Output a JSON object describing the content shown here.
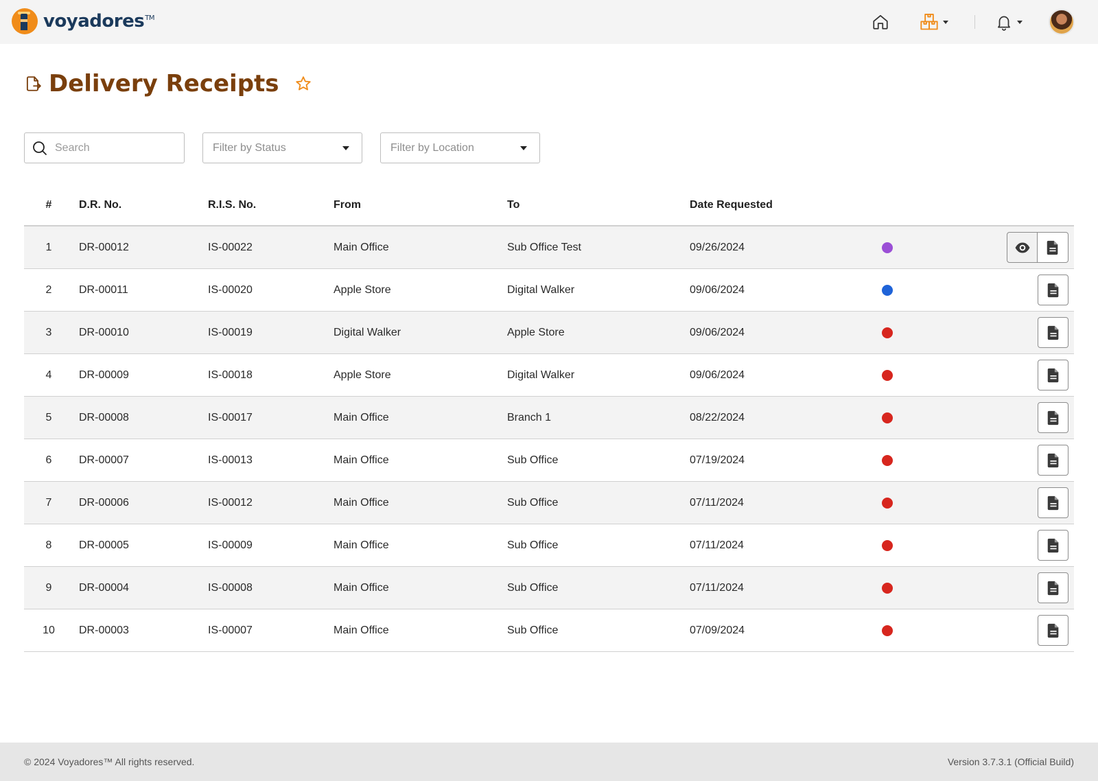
{
  "app": {
    "brand": "voyadores",
    "brand_tm": "TM"
  },
  "nav": {
    "home_icon": "home-icon",
    "inventory_icon": "boxes-icon",
    "notifications_icon": "bell-icon",
    "accent_color": "#f08c1a"
  },
  "page": {
    "title": "Delivery Receipts",
    "title_color": "#7a3f0c"
  },
  "filters": {
    "search_placeholder": "Search",
    "status_placeholder": "Filter by Status",
    "location_placeholder": "Filter by Location"
  },
  "table": {
    "headers": {
      "num": "#",
      "dr": "D.R. No.",
      "ris": "R.I.S. No.",
      "from": "From",
      "to": "To",
      "date": "Date Requested"
    },
    "rows": [
      {
        "num": "1",
        "dr": "DR-00012",
        "ris": "IS-00022",
        "from": "Main Office",
        "to": "Sub Office Test",
        "date": "09/26/2024",
        "status_color": "#9b4fd6",
        "has_view": true
      },
      {
        "num": "2",
        "dr": "DR-00011",
        "ris": "IS-00020",
        "from": "Apple Store",
        "to": "Digital Walker",
        "date": "09/06/2024",
        "status_color": "#1f63d8",
        "has_view": false
      },
      {
        "num": "3",
        "dr": "DR-00010",
        "ris": "IS-00019",
        "from": "Digital Walker",
        "to": "Apple Store",
        "date": "09/06/2024",
        "status_color": "#d7261e",
        "has_view": false
      },
      {
        "num": "4",
        "dr": "DR-00009",
        "ris": "IS-00018",
        "from": "Apple Store",
        "to": "Digital Walker",
        "date": "09/06/2024",
        "status_color": "#d7261e",
        "has_view": false
      },
      {
        "num": "5",
        "dr": "DR-00008",
        "ris": "IS-00017",
        "from": "Main Office",
        "to": "Branch 1",
        "date": "08/22/2024",
        "status_color": "#d7261e",
        "has_view": false
      },
      {
        "num": "6",
        "dr": "DR-00007",
        "ris": "IS-00013",
        "from": "Main Office",
        "to": "Sub Office",
        "date": "07/19/2024",
        "status_color": "#d7261e",
        "has_view": false
      },
      {
        "num": "7",
        "dr": "DR-00006",
        "ris": "IS-00012",
        "from": "Main Office",
        "to": "Sub Office",
        "date": "07/11/2024",
        "status_color": "#d7261e",
        "has_view": false
      },
      {
        "num": "8",
        "dr": "DR-00005",
        "ris": "IS-00009",
        "from": "Main Office",
        "to": "Sub Office",
        "date": "07/11/2024",
        "status_color": "#d7261e",
        "has_view": false
      },
      {
        "num": "9",
        "dr": "DR-00004",
        "ris": "IS-00008",
        "from": "Main Office",
        "to": "Sub Office",
        "date": "07/11/2024",
        "status_color": "#d7261e",
        "has_view": false
      },
      {
        "num": "10",
        "dr": "DR-00003",
        "ris": "IS-00007",
        "from": "Main Office",
        "to": "Sub Office",
        "date": "07/09/2024",
        "status_color": "#d7261e",
        "has_view": false
      }
    ]
  },
  "footer": {
    "copyright": "© 2024 Voyadores™ All rights reserved.",
    "version": "Version 3.7.3.1 (Official Build)"
  }
}
